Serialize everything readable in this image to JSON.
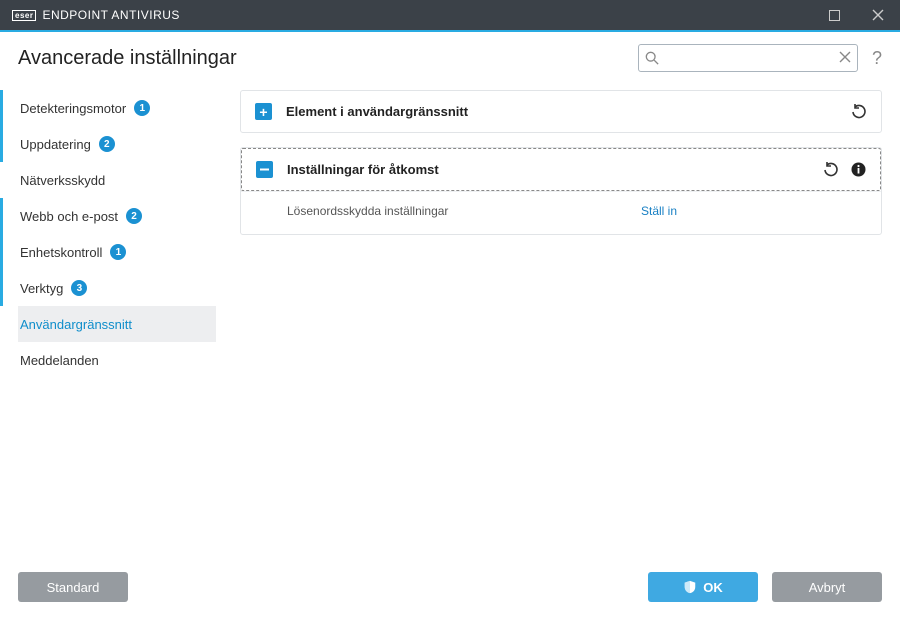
{
  "titlebar": {
    "brand_box": "eser",
    "brand_text": "ENDPOINT ANTIVIRUS"
  },
  "header": {
    "title": "Avancerade inställningar"
  },
  "search": {
    "placeholder": "",
    "value": ""
  },
  "sidebar": {
    "items": [
      {
        "label": "Detekteringsmotor",
        "badge": "1",
        "barred": true,
        "active": false
      },
      {
        "label": "Uppdatering",
        "badge": "2",
        "barred": true,
        "active": false
      },
      {
        "label": "Nätverksskydd",
        "badge": "",
        "barred": false,
        "active": false
      },
      {
        "label": "Webb och e-post",
        "badge": "2",
        "barred": true,
        "active": false
      },
      {
        "label": "Enhetskontroll",
        "badge": "1",
        "barred": true,
        "active": false
      },
      {
        "label": "Verktyg",
        "badge": "3",
        "barred": true,
        "active": false
      },
      {
        "label": "Användargränssnitt",
        "badge": "",
        "barred": false,
        "active": true
      },
      {
        "label": "Meddelanden",
        "badge": "",
        "barred": false,
        "active": false
      }
    ]
  },
  "panels": {
    "ui_elements": {
      "title": "Element i användargränssnitt"
    },
    "access": {
      "title": "Inställningar för åtkomst",
      "password_label": "Lösenordsskydda inställningar",
      "password_action": "Ställ in"
    }
  },
  "footer": {
    "default": "Standard",
    "ok": "OK",
    "cancel": "Avbryt"
  },
  "colors": {
    "accent": "#29abe2"
  }
}
